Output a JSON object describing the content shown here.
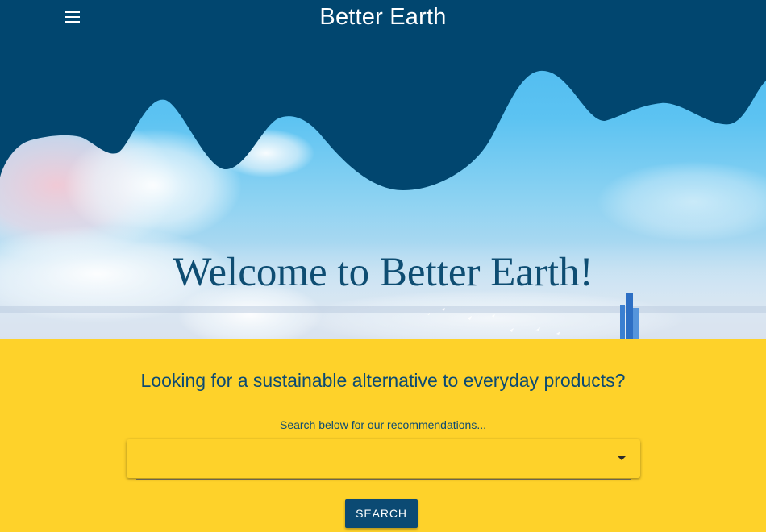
{
  "header": {
    "title": "Better Earth",
    "menu_icon": "menu-icon"
  },
  "hero": {
    "heading": "Welcome to Better Earth!"
  },
  "search_section": {
    "question": "Looking for a sustainable alternative to everyday products?",
    "instruction": "Search below for our recommendations...",
    "dropdown": {
      "selected_value": "",
      "icon": "arrow-drop-down-icon"
    },
    "search_label": "SEARCH"
  },
  "colors": {
    "header_navy": "#01466f",
    "accent_yellow": "#fed22a",
    "text_navy": "#0c4a72",
    "button_navy": "#0b4a73"
  }
}
